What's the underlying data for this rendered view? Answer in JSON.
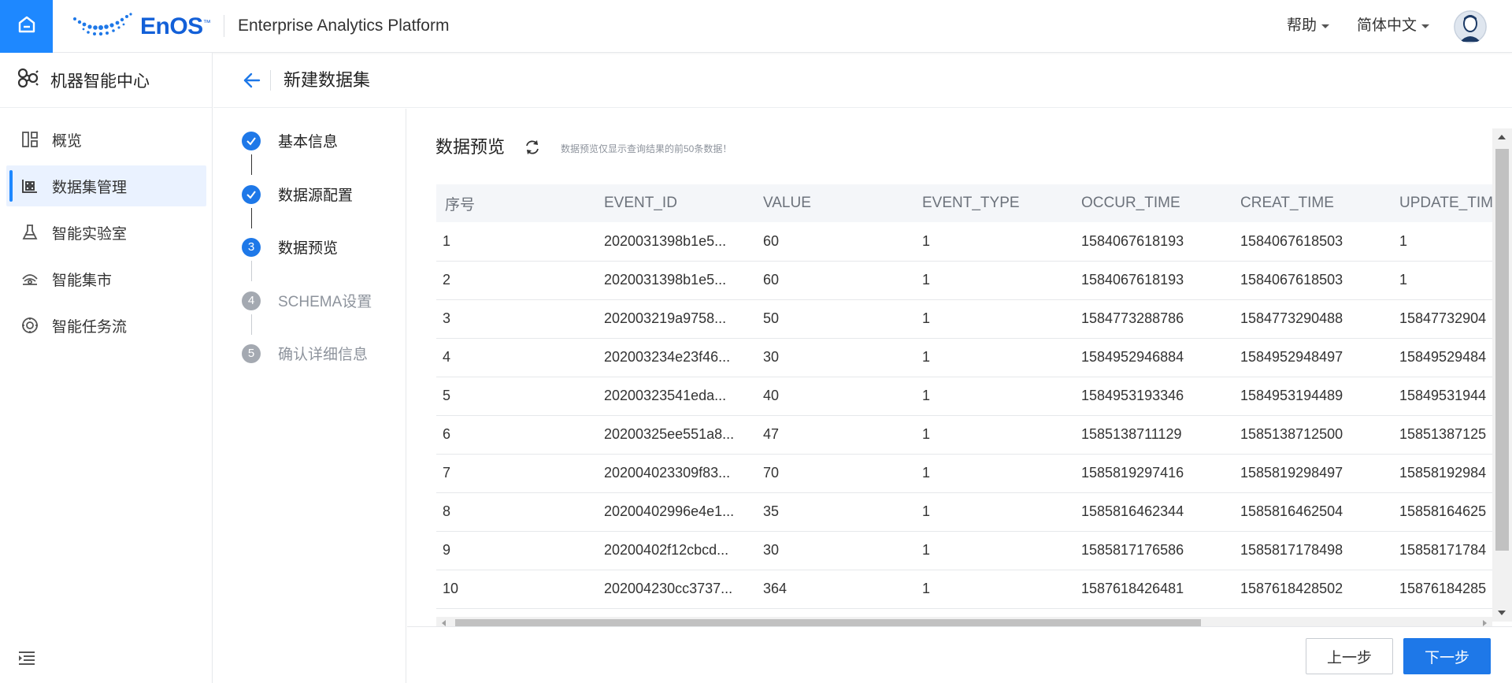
{
  "brand": {
    "logo_text": "EnOS",
    "logo_tm": "™",
    "app_title": "Enterprise Analytics Platform",
    "primary_color": "#1e88ff"
  },
  "top_menu": {
    "help": "帮助",
    "language": "简体中文"
  },
  "sidebar": {
    "title": "机器智能中心",
    "items": [
      {
        "label": "概览",
        "icon": "dashboard-icon"
      },
      {
        "label": "数据集管理",
        "icon": "dataset-icon",
        "active": true
      },
      {
        "label": "智能实验室",
        "icon": "flask-icon"
      },
      {
        "label": "智能集市",
        "icon": "market-icon"
      },
      {
        "label": "智能任务流",
        "icon": "workflow-icon"
      }
    ]
  },
  "page": {
    "title": "新建数据集"
  },
  "steps": [
    {
      "label": "基本信息",
      "state": "done",
      "number": "1"
    },
    {
      "label": "数据源配置",
      "state": "done",
      "number": "2"
    },
    {
      "label": "数据预览",
      "state": "current",
      "number": "3"
    },
    {
      "label": "SCHEMA设置",
      "state": "todo",
      "number": "4"
    },
    {
      "label": "确认详细信息",
      "state": "todo",
      "number": "5"
    }
  ],
  "preview": {
    "title": "数据预览",
    "hint": "数据预览仅显示查询结果的前50条数据！"
  },
  "table": {
    "columns": [
      "序号",
      "EVENT_ID",
      "VALUE",
      "EVENT_TYPE",
      "OCCUR_TIME",
      "CREAT_TIME",
      "UPDATE_TIM"
    ],
    "rows": [
      [
        "1",
        "2020031398b1e5...",
        "60",
        "1",
        "1584067618193",
        "1584067618503",
        "1"
      ],
      [
        "2",
        "2020031398b1e5...",
        "60",
        "1",
        "1584067618193",
        "1584067618503",
        "1"
      ],
      [
        "3",
        "202003219a9758...",
        "50",
        "1",
        "1584773288786",
        "1584773290488",
        "15847732904"
      ],
      [
        "4",
        "202003234e23f46...",
        "30",
        "1",
        "1584952946884",
        "1584952948497",
        "15849529484"
      ],
      [
        "5",
        "20200323541eda...",
        "40",
        "1",
        "1584953193346",
        "1584953194489",
        "15849531944"
      ],
      [
        "6",
        "20200325ee551a8...",
        "47",
        "1",
        "1585138711129",
        "1585138712500",
        "15851387125"
      ],
      [
        "7",
        "202004023309f83...",
        "70",
        "1",
        "1585819297416",
        "1585819298497",
        "15858192984"
      ],
      [
        "8",
        "20200402996e4e1...",
        "35",
        "1",
        "1585816462344",
        "1585816462504",
        "15858164625"
      ],
      [
        "9",
        "20200402f12cbcd...",
        "30",
        "1",
        "1585817176586",
        "1585817178498",
        "15858171784"
      ],
      [
        "10",
        "202004230cc3737...",
        "364",
        "1",
        "1587618426481",
        "1587618428502",
        "15876184285"
      ]
    ]
  },
  "footer": {
    "prev_label": "上一步",
    "next_label": "下一步"
  }
}
